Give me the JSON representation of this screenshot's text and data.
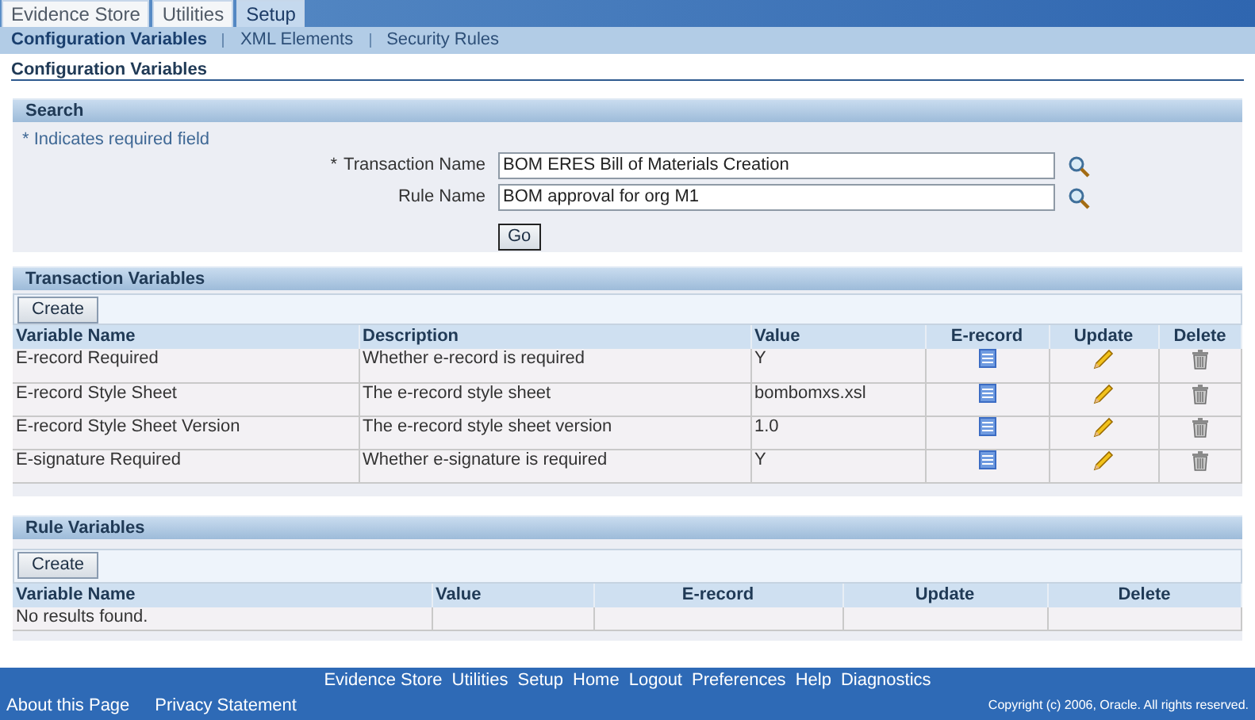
{
  "tabs": [
    {
      "label": "Evidence Store",
      "selected": false
    },
    {
      "label": "Utilities",
      "selected": false
    },
    {
      "label": "Setup",
      "selected": true
    }
  ],
  "subtabs": [
    {
      "label": "Configuration Variables",
      "selected": true
    },
    {
      "label": "XML Elements",
      "selected": false
    },
    {
      "label": "Security Rules",
      "selected": false
    }
  ],
  "page_title": "Configuration Variables",
  "search": {
    "title": "Search",
    "required_note": "* Indicates required field",
    "fields": [
      {
        "required_mark": "*",
        "label": "Transaction Name",
        "value": "BOM ERES Bill of Materials Creation"
      },
      {
        "label": "Rule Name",
        "value": "BOM approval for org M1"
      }
    ],
    "go_button": "Go"
  },
  "transaction_variables": {
    "title": "Transaction Variables",
    "create_button": "Create",
    "columns": [
      "Variable Name",
      "Description",
      "Value",
      "E-record",
      "Update",
      "Delete"
    ],
    "rows": [
      {
        "name": "E-record Required",
        "description": "Whether e-record is required",
        "value": "Y"
      },
      {
        "name": "E-record Style Sheet",
        "description": "The e-record style sheet",
        "value": "bombomxs.xsl"
      },
      {
        "name": "E-record Style Sheet Version",
        "description": "The e-record style sheet version",
        "value": "1.0"
      },
      {
        "name": "E-signature Required",
        "description": "Whether e-signature is required",
        "value": "Y"
      }
    ]
  },
  "rule_variables": {
    "title": "Rule Variables",
    "create_button": "Create",
    "columns": [
      "Variable Name",
      "Value",
      "E-record",
      "Update",
      "Delete"
    ],
    "empty_message": "No results found."
  },
  "footer": {
    "links": [
      "Evidence Store",
      "Utilities",
      "Setup",
      "Home",
      "Logout",
      "Preferences",
      "Help",
      "Diagnostics"
    ],
    "bottom_links": [
      "About this Page",
      "Privacy Statement"
    ],
    "copyright": "Copyright (c) 2006, Oracle. All rights reserved."
  }
}
